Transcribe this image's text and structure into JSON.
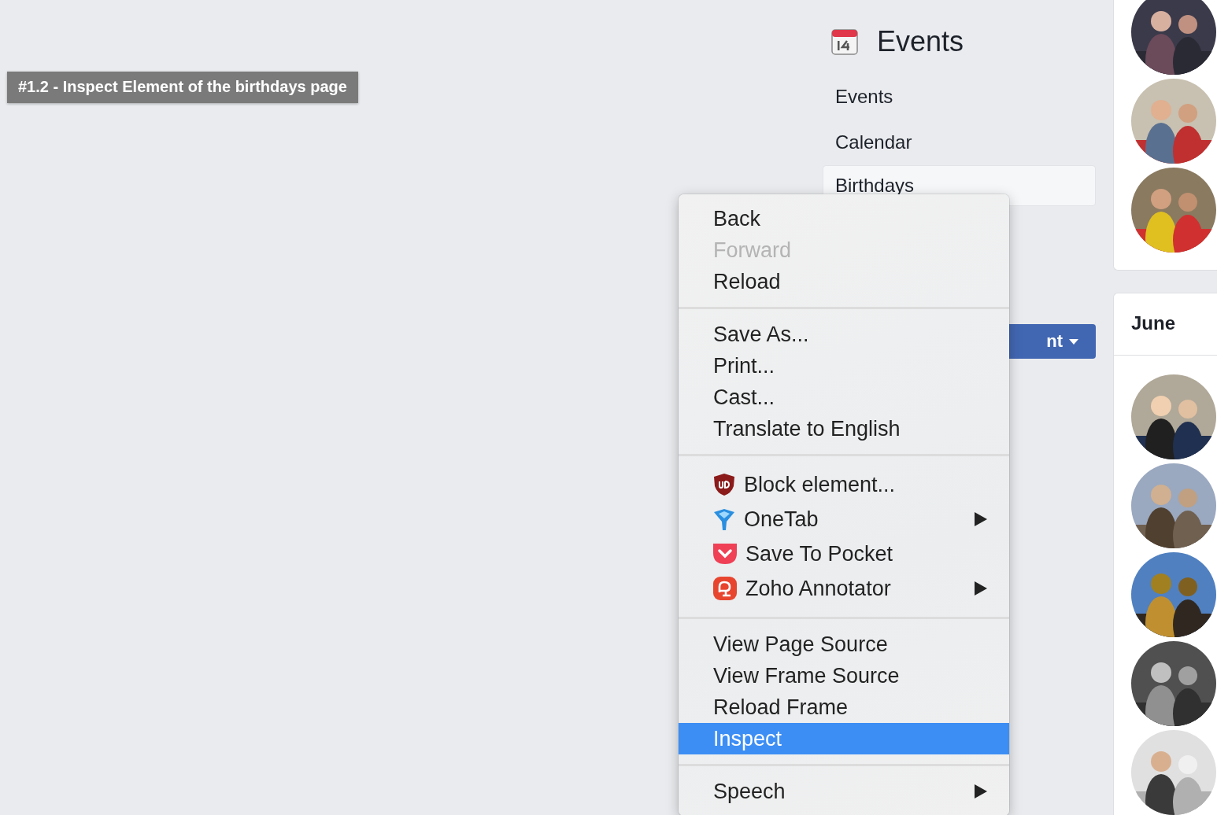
{
  "caption": "#1.2 - Inspect Element of the birthdays page",
  "nav": {
    "title": "Events",
    "items": [
      {
        "label": "Events",
        "selected": false
      },
      {
        "label": "Calendar",
        "selected": false
      },
      {
        "label": "Birthdays",
        "selected": true
      }
    ],
    "button": {
      "label": "nt"
    }
  },
  "cards": [
    {
      "avatars": [
        {
          "kind": "picture"
        },
        {
          "kind": "picture"
        },
        {
          "kind": "picture"
        }
      ]
    },
    {
      "title": "June",
      "avatars": [
        {
          "kind": "picture"
        },
        {
          "kind": "picture"
        },
        {
          "kind": "picture"
        },
        {
          "kind": "picture"
        },
        {
          "kind": "picture"
        }
      ]
    }
  ],
  "context_menu": {
    "sections": [
      {
        "items": [
          {
            "label": "Back",
            "kind": "plain",
            "disabled": false,
            "selected": false,
            "submenu": false
          },
          {
            "label": "Forward",
            "kind": "plain",
            "disabled": true,
            "selected": false,
            "submenu": false
          },
          {
            "label": "Reload",
            "kind": "plain",
            "disabled": false,
            "selected": false,
            "submenu": false
          }
        ]
      },
      {
        "items": [
          {
            "label": "Save As...",
            "kind": "plain",
            "disabled": false,
            "selected": false,
            "submenu": false
          },
          {
            "label": "Print...",
            "kind": "plain",
            "disabled": false,
            "selected": false,
            "submenu": false
          },
          {
            "label": "Cast...",
            "kind": "plain",
            "disabled": false,
            "selected": false,
            "submenu": false
          },
          {
            "label": "Translate to English",
            "kind": "plain",
            "disabled": false,
            "selected": false,
            "submenu": false
          }
        ]
      },
      {
        "items": [
          {
            "label": "Block element...",
            "kind": "extension",
            "disabled": false,
            "selected": false,
            "submenu": false
          },
          {
            "label": "OneTab",
            "kind": "extension",
            "disabled": false,
            "selected": false,
            "submenu": true
          },
          {
            "label": "Save To Pocket",
            "kind": "extension",
            "disabled": false,
            "selected": false,
            "submenu": false
          },
          {
            "label": "Zoho Annotator",
            "kind": "extension",
            "disabled": false,
            "selected": false,
            "submenu": true
          }
        ]
      },
      {
        "items": [
          {
            "label": "View Page Source",
            "kind": "plain",
            "disabled": false,
            "selected": false,
            "submenu": false
          },
          {
            "label": "View Frame Source",
            "kind": "plain",
            "disabled": false,
            "selected": false,
            "submenu": false
          },
          {
            "label": "Reload Frame",
            "kind": "plain",
            "disabled": false,
            "selected": false,
            "submenu": false
          },
          {
            "label": "Inspect",
            "kind": "plain",
            "disabled": false,
            "selected": true,
            "submenu": false
          }
        ]
      },
      {
        "items": [
          {
            "label": "Speech",
            "kind": "plain",
            "disabled": false,
            "selected": false,
            "submenu": true
          }
        ]
      }
    ]
  }
}
